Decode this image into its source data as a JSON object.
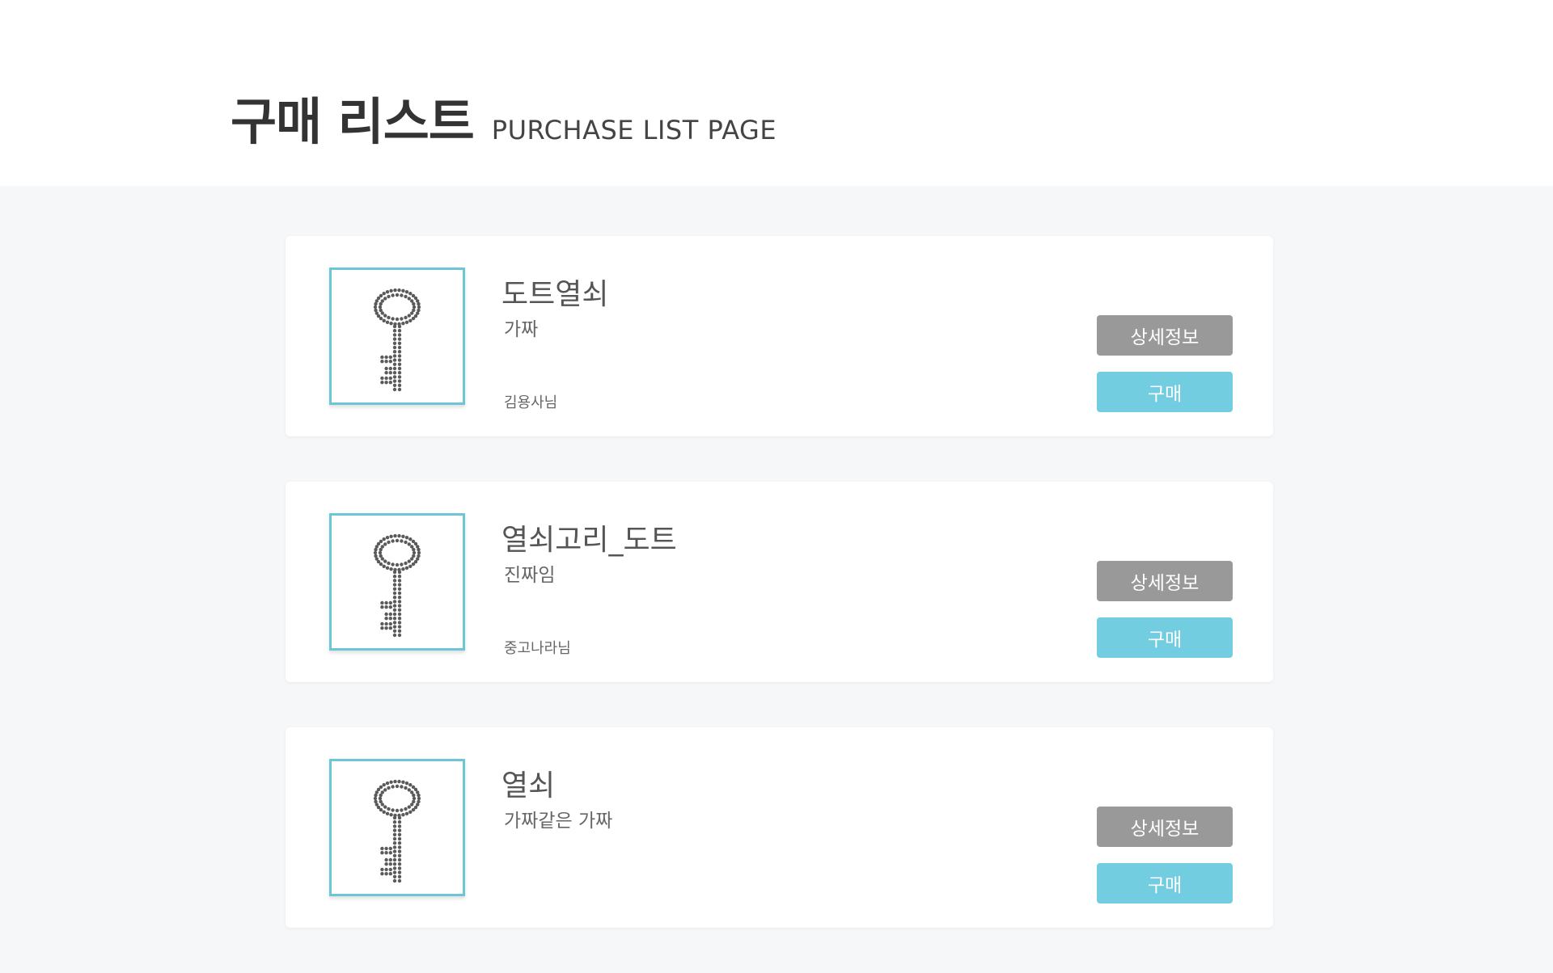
{
  "header": {
    "title_ko": "구매 리스트",
    "title_en": "PURCHASE LIST PAGE"
  },
  "colors": {
    "accent": "#72cde0",
    "detail_button": "#999999",
    "background": "#f6f7f9"
  },
  "items": [
    {
      "name": "도트열쇠",
      "description": "가짜",
      "seller": "김용사님",
      "detail_label": "상세정보",
      "buy_label": "구매",
      "image_icon": "dot-key-icon"
    },
    {
      "name": "열쇠고리_도트",
      "description": "진짜임",
      "seller": "중고나라님",
      "detail_label": "상세정보",
      "buy_label": "구매",
      "image_icon": "dot-key-icon"
    },
    {
      "name": "열쇠",
      "description": "가짜같은 가짜",
      "seller": "",
      "detail_label": "상세정보",
      "buy_label": "구매",
      "image_icon": "dot-key-icon"
    }
  ]
}
